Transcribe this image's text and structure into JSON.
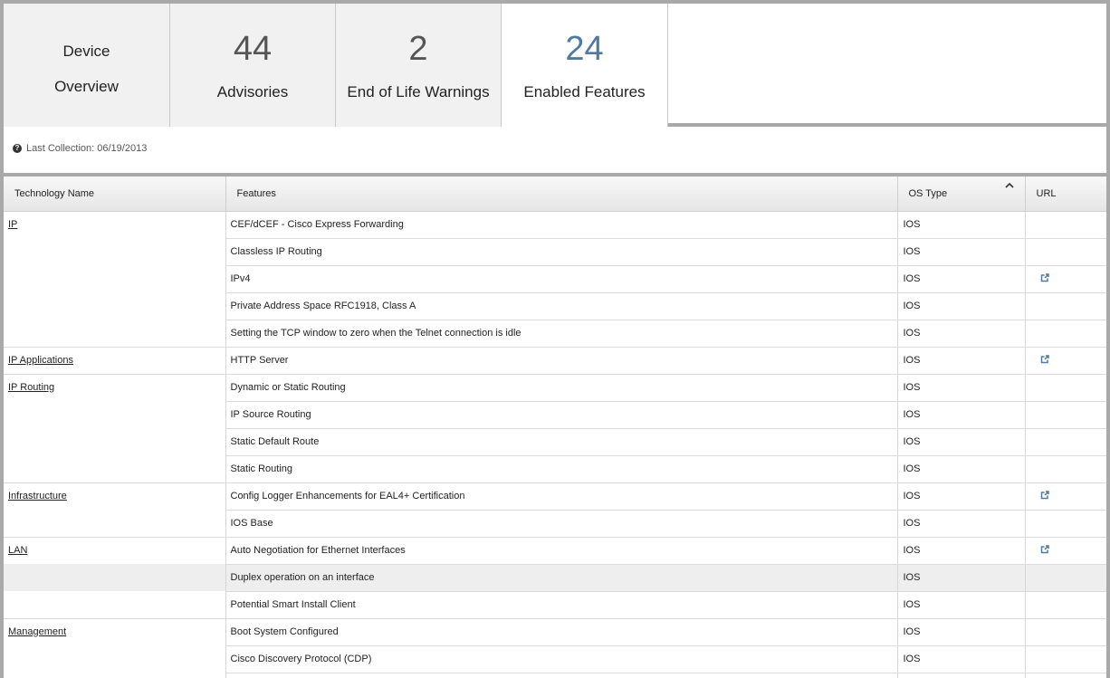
{
  "tabs": [
    {
      "title_top": "Device",
      "title_bottom": "Overview"
    },
    {
      "number": "44",
      "label": "Advisories"
    },
    {
      "number": "2",
      "label": "End of Life Warnings"
    },
    {
      "number": "24",
      "label": "Enabled Features"
    }
  ],
  "info": {
    "last_collection": "Last Collection: 06/19/2013",
    "icon": "question-circle-icon"
  },
  "table": {
    "headers": {
      "technology": "Technology Name",
      "features": "Features",
      "os_type": "OS Type",
      "url": "URL"
    },
    "sort_icon": "chevron-up-icon",
    "url_icon": "external-link-icon",
    "rows": [
      {
        "tech": "IP",
        "feature": "CEF/dCEF - Cisco Express Forwarding",
        "os": "IOS",
        "url": false
      },
      {
        "tech": "",
        "feature": "Classless IP Routing",
        "os": "IOS",
        "url": false
      },
      {
        "tech": "",
        "feature": "IPv4",
        "os": "IOS",
        "url": true
      },
      {
        "tech": "",
        "feature": "Private Address Space RFC1918, Class A",
        "os": "IOS",
        "url": false
      },
      {
        "tech": "",
        "feature": "Setting the TCP window to zero when the Telnet connection is idle",
        "os": "IOS",
        "url": false
      },
      {
        "tech": "IP Applications",
        "feature": "HTTP Server",
        "os": "IOS",
        "url": true
      },
      {
        "tech": "IP Routing",
        "feature": "Dynamic or Static Routing",
        "os": "IOS",
        "url": false
      },
      {
        "tech": "",
        "feature": "IP Source Routing",
        "os": "IOS",
        "url": false
      },
      {
        "tech": "",
        "feature": "Static Default Route",
        "os": "IOS",
        "url": false
      },
      {
        "tech": "",
        "feature": "Static Routing",
        "os": "IOS",
        "url": false
      },
      {
        "tech": "Infrastructure",
        "feature": "Config Logger Enhancements for EAL4+ Certification",
        "os": "IOS",
        "url": true
      },
      {
        "tech": "",
        "feature": "IOS Base",
        "os": "IOS",
        "url": false
      },
      {
        "tech": "LAN",
        "feature": "Auto Negotiation for Ethernet Interfaces",
        "os": "IOS",
        "url": true
      },
      {
        "tech": "",
        "feature": "Duplex operation on an interface",
        "os": "IOS",
        "url": false,
        "highlighted": true
      },
      {
        "tech": "",
        "feature": "Potential Smart Install Client",
        "os": "IOS",
        "url": false
      },
      {
        "tech": "Management",
        "feature": "Boot System Configured",
        "os": "IOS",
        "url": false
      },
      {
        "tech": "",
        "feature": "Cisco Discovery Protocol (CDP)",
        "os": "IOS",
        "url": false
      },
      {
        "tech": "",
        "feature": "",
        "os": "",
        "url": false
      }
    ]
  }
}
